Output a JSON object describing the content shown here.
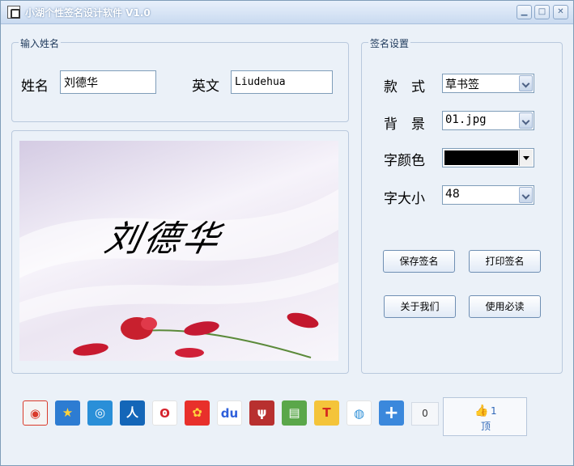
{
  "window": {
    "title": "小湖个性签名设计软件 V1.0",
    "min_icon": "minimize-icon",
    "max_icon": "maximize-icon",
    "close_icon": "close-icon"
  },
  "input_group": {
    "label": "输入姓名",
    "name_label": "姓名",
    "name_value": "刘德华",
    "english_label": "英文",
    "english_value": "Liudehua"
  },
  "preview": {
    "signature_text": "刘德华"
  },
  "settings": {
    "label": "签名设置",
    "style_label": "款　式",
    "style_value": "草书签",
    "background_label": "背　景",
    "background_value": "01.jpg",
    "color_label": "字颜色",
    "color_value": "#000000",
    "size_label": "字大小",
    "size_value": "48",
    "save_button": "保存签名",
    "print_button": "打印签名",
    "about_button": "关于我们",
    "help_button": "使用必读"
  },
  "share": {
    "icons": [
      "weibo-icon",
      "favorite-star-icon",
      "qzone-icon",
      "renren-icon",
      "tencent-weibo-icon",
      "kaixin-icon",
      "baidu-icon",
      "douban-icon",
      "pengyou-icon",
      "t-icon",
      "sohu-icon",
      "more-plus-icon"
    ],
    "count": "0",
    "like_count": "1",
    "like_label": "顶"
  }
}
